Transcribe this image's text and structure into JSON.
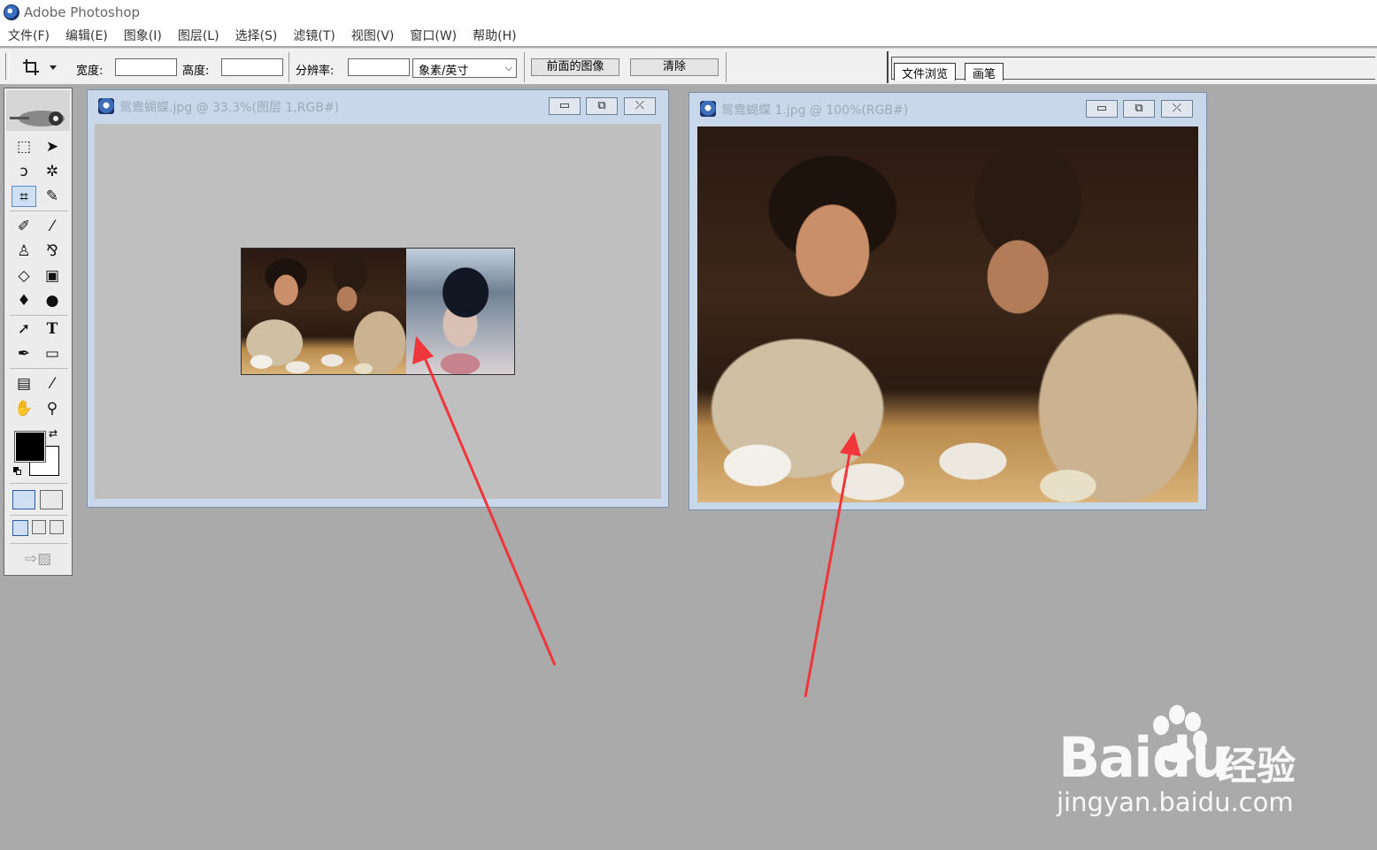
{
  "app": {
    "title": "Adobe Photoshop"
  },
  "menu": [
    "文件(F)",
    "编辑(E)",
    "图象(I)",
    "图层(L)",
    "选择(S)",
    "滤镜(T)",
    "视图(V)",
    "窗口(W)",
    "帮助(H)"
  ],
  "options_bar": {
    "width_label": "宽度:",
    "height_label": "高度:",
    "resolution_label": "分辨率:",
    "width_value": "",
    "height_value": "",
    "resolution_value": "",
    "unit_selected": "象素/英寸",
    "front_image_button": "前面的图像",
    "clear_button": "清除"
  },
  "palette_well": {
    "tabs": [
      "文件浏览",
      "画笔"
    ]
  },
  "documents": [
    {
      "title": "鸳鸯蝴蝶.jpg @ 33.3%(图层 1,RGB#)"
    },
    {
      "title": "鸳鸯蝴蝶 1.jpg @ 100%(RGB#)"
    }
  ],
  "window_buttons": {
    "minimize": "▭",
    "restore": "⧉",
    "close": "⤫"
  },
  "colors": {
    "foreground": "#000000",
    "background": "#ffffff",
    "arrow": "#f0353b"
  },
  "watermark": {
    "brand": "Bai",
    "brand_du": "du",
    "brand_cn": "经验",
    "url": "jingyan.baidu.com"
  }
}
